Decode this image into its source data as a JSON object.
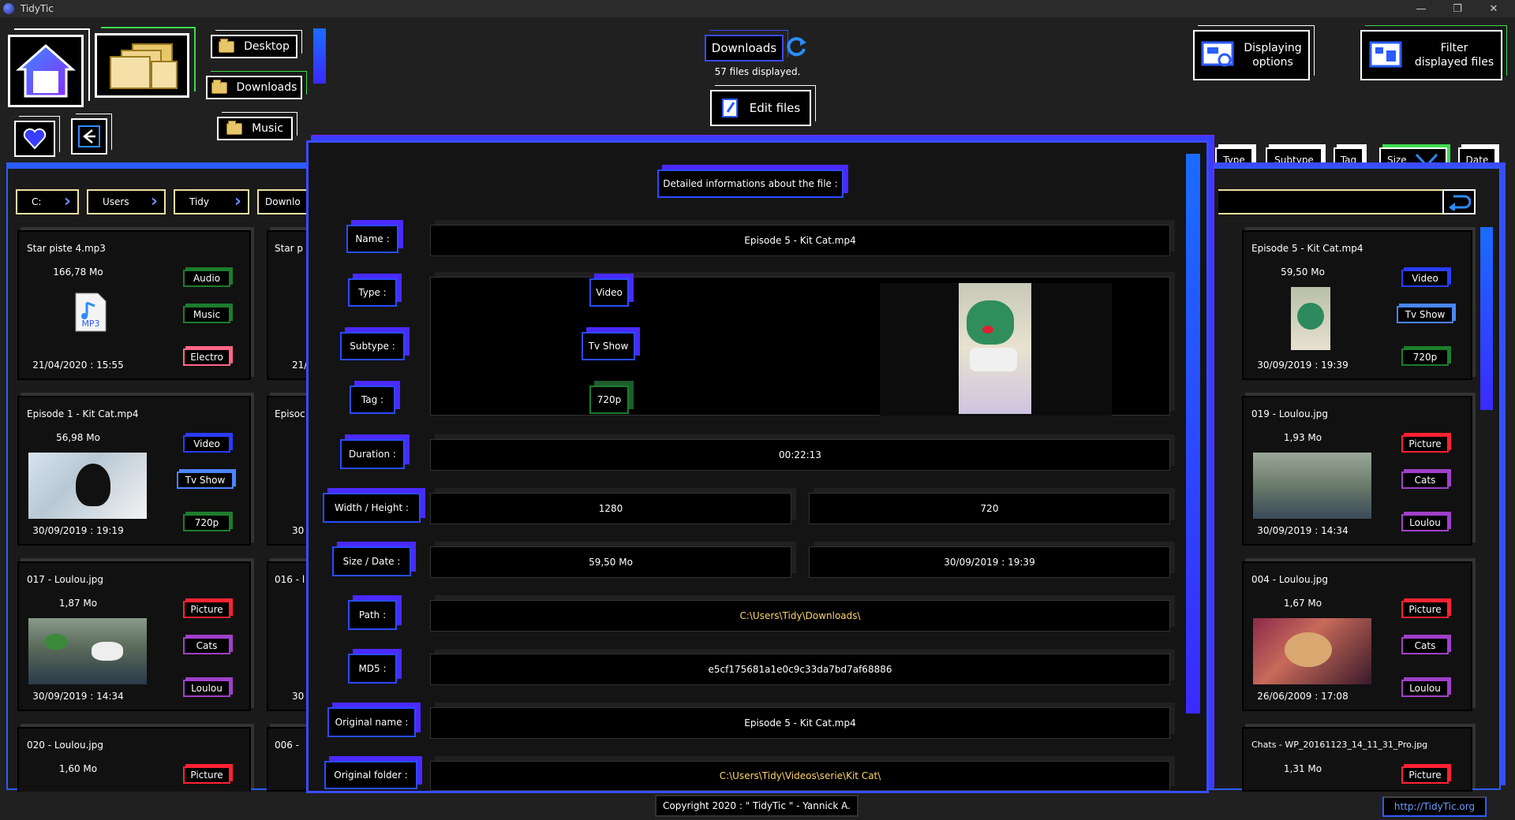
{
  "window": {
    "title": "TidyTic",
    "controls": [
      "—",
      "❐",
      "✕"
    ]
  },
  "nav": {
    "desktop": "Desktop",
    "downloads": "Downloads",
    "music": "Music"
  },
  "header": {
    "folder": "Downloads",
    "files_count": "57 files displayed.",
    "edit_files": "Edit files",
    "displaying_options": [
      "Displaying",
      "options"
    ],
    "filter": [
      "Filter",
      "displayed files"
    ]
  },
  "breadcrumb": [
    "C:",
    "Users",
    "Tidy",
    "Downlo"
  ],
  "sort": [
    "Type",
    "Subtype",
    "Tag",
    "Size",
    "Date"
  ],
  "left_cards": [
    {
      "name": "Star piste 4.mp3",
      "size": "166,78 Mo",
      "date": "21/04/2020 : 15:55",
      "tags": [
        "Audio",
        "Music",
        "Electro"
      ]
    },
    {
      "name": "Episode 1 - Kit Cat.mp4",
      "size": "56,98 Mo",
      "date": "30/09/2019 : 19:19",
      "tags": [
        "Video",
        "Tv Show",
        "720p"
      ]
    },
    {
      "name": "017 - Loulou.jpg",
      "size": "1,87 Mo",
      "date": "30/09/2019 : 14:34",
      "tags": [
        "Picture",
        "Cats",
        "Loulou"
      ]
    },
    {
      "name": "020 - Loulou.jpg",
      "size": "1,60 Mo",
      "date": "",
      "tags": [
        "Picture"
      ]
    }
  ],
  "mid_cards": [
    {
      "name": "Star p",
      "date": "21/"
    },
    {
      "name": "Episoc",
      "date": "30"
    },
    {
      "name": "016 - l",
      "date": "30"
    },
    {
      "name": "006 -",
      "date": ""
    }
  ],
  "right_cards": [
    {
      "name": "Episode 5 - Kit Cat.mp4",
      "size": "59,50 Mo",
      "date": "30/09/2019 : 19:39",
      "tags": [
        "Video",
        "Tv Show",
        "720p"
      ]
    },
    {
      "name": "019 - Loulou.jpg",
      "size": "1,93 Mo",
      "date": "30/09/2019 : 14:34",
      "tags": [
        "Picture",
        "Cats",
        "Loulou"
      ]
    },
    {
      "name": "004 - Loulou.jpg",
      "size": "1,67 Mo",
      "date": "26/06/2009 : 17:08",
      "tags": [
        "Picture",
        "Cats",
        "Loulou"
      ]
    },
    {
      "name": "Chats - WP_20161123_14_11_31_Pro.jpg",
      "size": "1,31 Mo",
      "date": "",
      "tags": [
        "Picture"
      ]
    }
  ],
  "modal": {
    "title": "Detailed informations about the file :",
    "labels": {
      "name": "Name :",
      "type": "Type :",
      "subtype": "Subtype :",
      "tag": "Tag :",
      "duration": "Duration :",
      "wh": "Width / Height :",
      "sd": "Size / Date :",
      "path": "Path :",
      "md5": "MD5 :",
      "orig_name": "Original name :",
      "orig_folder": "Original folder :"
    },
    "values": {
      "name": "Episode 5 - Kit Cat.mp4",
      "type": "Video",
      "subtype": "Tv Show",
      "tag": "720p",
      "duration": "00:22:13",
      "width": "1280",
      "height": "720",
      "size": "59,50 Mo",
      "date": "30/09/2019 : 19:39",
      "path": "C:\\Users\\Tidy\\Downloads\\",
      "md5": "e5cf175681a1e0c9c33da7bd7af68886",
      "orig_name": "Episode 5 - Kit Cat.mp4",
      "orig_folder": "C:\\Users\\Tidy\\Videos\\serie\\Kit Cat\\"
    }
  },
  "footer": {
    "copyright": "Copyright 2020 : \" TidyTic \" - Yannick A.",
    "link": "http://TidyTic.org"
  },
  "colors": {
    "accent_blue": "#2b5cff",
    "accent_purple": "#7a2aff",
    "accent_green": "#3ddc4e",
    "gold": "#ffd36a"
  }
}
